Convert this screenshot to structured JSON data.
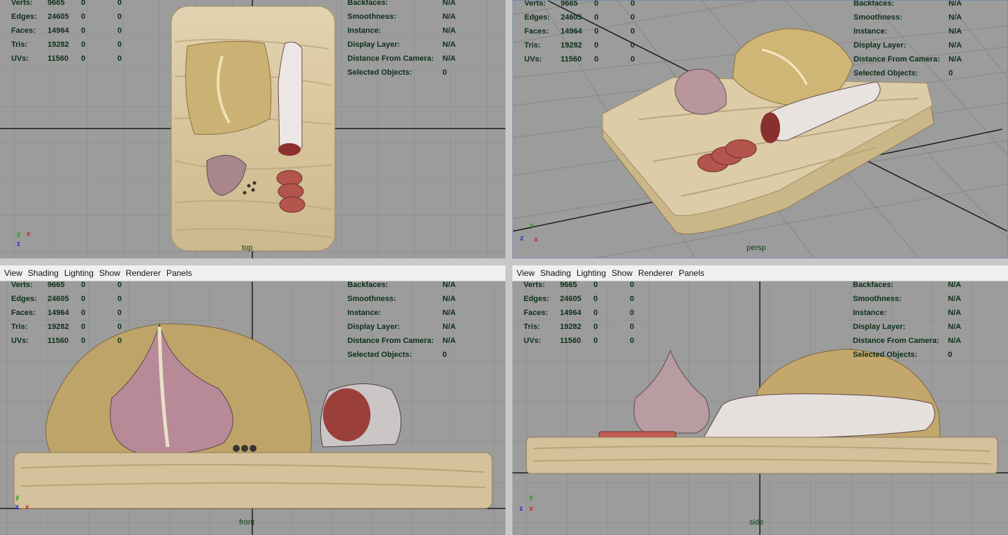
{
  "menu": [
    "View",
    "Shading",
    "Lighting",
    "Show",
    "Renderer",
    "Panels"
  ],
  "hud_left": [
    {
      "label": "Verts:",
      "v1": "9665",
      "v2": "0",
      "v3": "0"
    },
    {
      "label": "Edges:",
      "v1": "24605",
      "v2": "0",
      "v3": "0"
    },
    {
      "label": "Faces:",
      "v1": "14964",
      "v2": "0",
      "v3": "0"
    },
    {
      "label": "Tris:",
      "v1": "19282",
      "v2": "0",
      "v3": "0"
    },
    {
      "label": "UVs:",
      "v1": "11560",
      "v2": "0",
      "v3": "0"
    }
  ],
  "hud_right": [
    {
      "label": "Backfaces:",
      "value": "N/A"
    },
    {
      "label": "Smoothness:",
      "value": "N/A"
    },
    {
      "label": "Instance:",
      "value": "N/A"
    },
    {
      "label": "Display Layer:",
      "value": "N/A"
    },
    {
      "label": "Distance From Camera:",
      "value": "N/A"
    },
    {
      "label": "Selected Objects:",
      "value": "0"
    }
  ],
  "cameras": {
    "top": "top",
    "persp": "persp",
    "front": "front",
    "side": "side"
  },
  "axes": {
    "x": "x",
    "y": "y",
    "z": "z"
  },
  "colors": {
    "viewport_bg": "#9c9c9c",
    "grid": "#858585",
    "grid_axis": "#1a1a1a",
    "hud_text": "#0c2f18",
    "wood": "#d8c7a0"
  }
}
